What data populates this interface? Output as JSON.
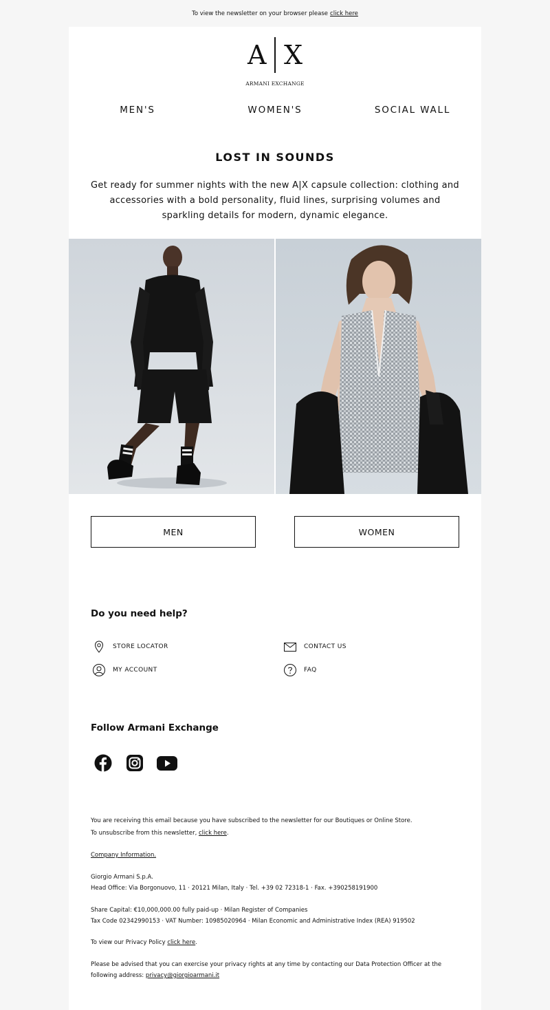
{
  "preheader": {
    "text": "To view the newsletter on your browser please",
    "link": "click here"
  },
  "logo": {
    "left": "A",
    "right": "X",
    "wordmark": "ARMANI EXCHANGE"
  },
  "nav": [
    {
      "label": "MEN'S"
    },
    {
      "label": "WOMEN'S"
    },
    {
      "label": "SOCIAL WALL"
    }
  ],
  "hero": {
    "title": "LOST IN SOUNDS",
    "body": "Get ready for summer nights with the new A|X capsule collection: clothing and accessories with a bold personality, fluid lines, surprising volumes and sparkling details for modern, dynamic elegance."
  },
  "buttons": {
    "men": "MEN",
    "women": "WOMEN"
  },
  "help": {
    "title": "Do you need help?",
    "store_locator": "STORE LOCATOR",
    "contact_us": "CONTACT US",
    "my_account": "MY ACCOUNT",
    "faq": "FAQ"
  },
  "follow": {
    "title": "Follow Armani Exchange"
  },
  "footer": {
    "subscription_line": "You are receiving this email because you have subscribed to the newsletter for our Boutiques or Online Store.",
    "unsubscribe_prefix": "To unsubscribe from this newsletter,",
    "unsubscribe_link": "click here",
    "company_info_link": "Company Information.",
    "company_name": "Giorgio Armani S.p.A.",
    "head_office": "Head Office: Via Borgonuovo, 11 · 20121 Milan, Italy · Tel. +39 02 72318-1 · Fax. +390258191900",
    "share_capital": "Share Capital: €10,000,000.00 fully paid-up · Milan Register of Companies",
    "tax_code": "Tax Code 02342990153 · VAT Number: 10985020964 · Milan Economic and Administrative Index (REA) 919502",
    "privacy_prefix": "To view our Privacy Policy",
    "privacy_link": "click here",
    "dpo_text": "Please be advised that you can exercise your privacy rights at any time by contacting our Data Protection Officer at the following address:",
    "dpo_email": "privacy@giorgioarmani.it"
  }
}
